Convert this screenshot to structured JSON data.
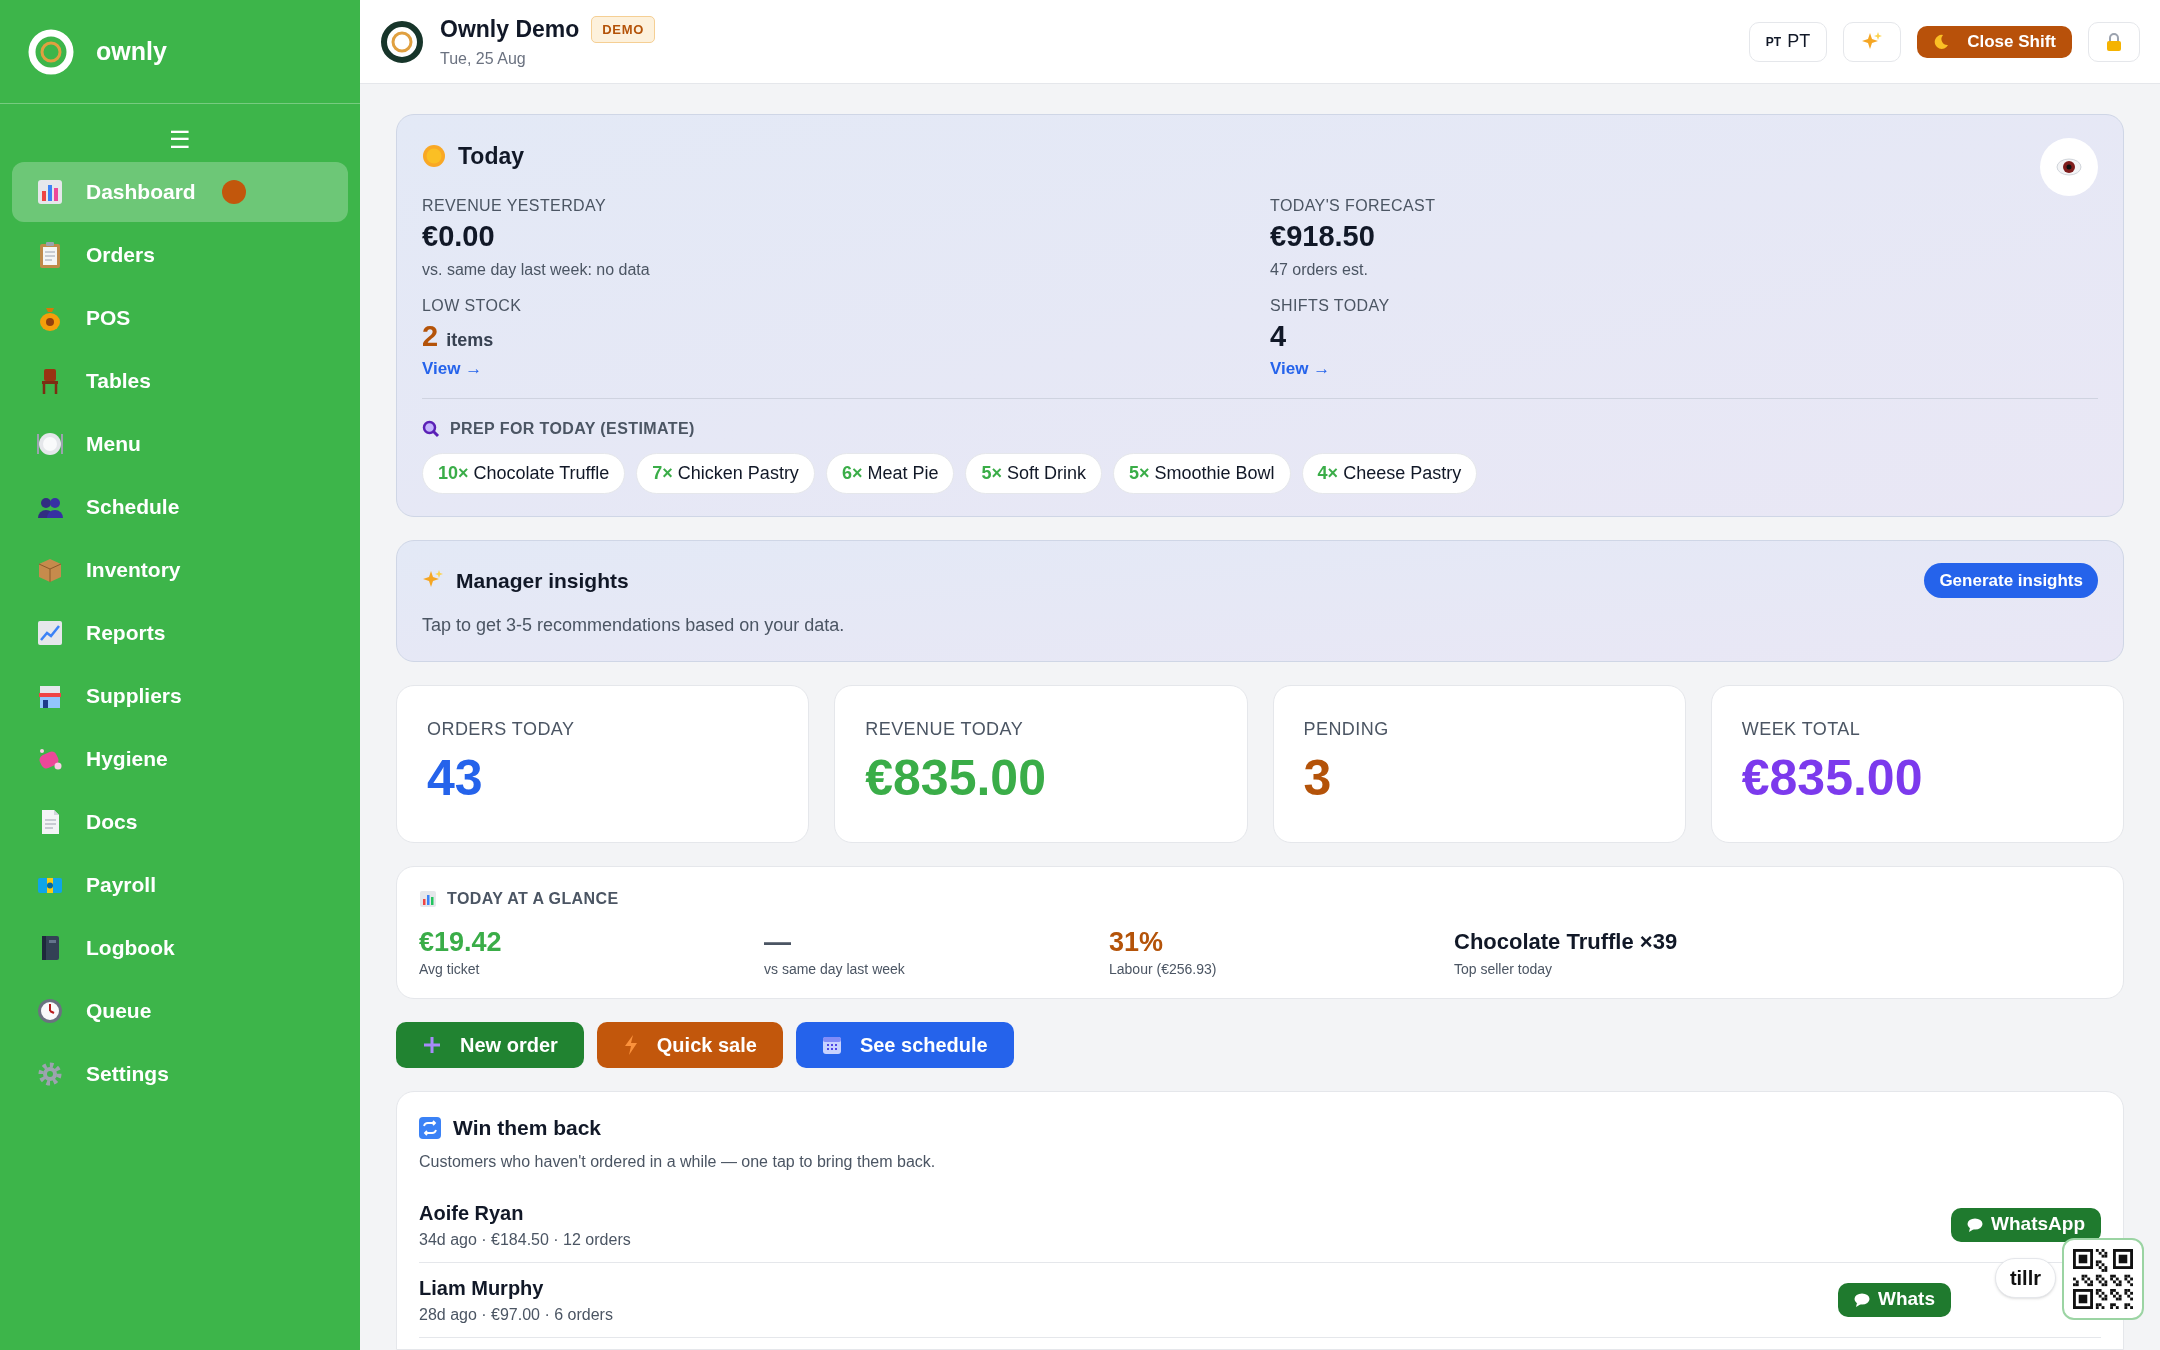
{
  "sidebar": {
    "brand": "ownly",
    "menu_glyph": "☰",
    "items": [
      {
        "label": "Dashboard",
        "selected": true,
        "badge": true
      },
      {
        "label": "Orders",
        "selected": false,
        "badge": false
      },
      {
        "label": "POS",
        "selected": false,
        "badge": false
      },
      {
        "label": "Tables",
        "selected": false,
        "badge": false
      },
      {
        "label": "Menu",
        "selected": false,
        "badge": false
      },
      {
        "label": "Schedule",
        "selected": false,
        "badge": false
      },
      {
        "label": "Inventory",
        "selected": false,
        "badge": false
      },
      {
        "label": "Reports",
        "selected": false,
        "badge": false
      },
      {
        "label": "Suppliers",
        "selected": false,
        "badge": false
      },
      {
        "label": "Hygiene",
        "selected": false,
        "badge": false
      },
      {
        "label": "Docs",
        "selected": false,
        "badge": false
      },
      {
        "label": "Payroll",
        "selected": false,
        "badge": false
      },
      {
        "label": "Logbook",
        "selected": false,
        "badge": false
      },
      {
        "label": "Queue",
        "selected": false,
        "badge": false
      },
      {
        "label": "Settings",
        "selected": false,
        "badge": false
      }
    ]
  },
  "header": {
    "title": "Ownly Demo",
    "badge": "DEMO",
    "date": "Tue, 25 Aug",
    "language": {
      "code": "PT",
      "label": "PT"
    },
    "close_shift": "Close Shift"
  },
  "today": {
    "title": "Today",
    "metrics": [
      {
        "label": "REVENUE YESTERDAY",
        "value": "€0.00",
        "color": "#111827",
        "note": "vs. same day last week: no data"
      },
      {
        "label": "TODAY'S FORECAST",
        "value": "€918.50",
        "color": "#111827",
        "note": "47 orders est."
      },
      {
        "label": "LOW STOCK",
        "value": "2",
        "color": "#b45309",
        "unit": "items",
        "link": "View →"
      },
      {
        "label": "SHIFTS TODAY",
        "value": "4",
        "color": "#111827",
        "link": "View →"
      }
    ],
    "prep_title": "PREP FOR TODAY (ESTIMATE)",
    "prep": [
      {
        "qty": "10×",
        "name": "Chocolate Truffle"
      },
      {
        "qty": "7×",
        "name": "Chicken Pastry"
      },
      {
        "qty": "6×",
        "name": "Meat Pie"
      },
      {
        "qty": "5×",
        "name": "Soft Drink"
      },
      {
        "qty": "5×",
        "name": "Smoothie Bowl"
      },
      {
        "qty": "4×",
        "name": "Cheese Pastry"
      }
    ]
  },
  "insights": {
    "title": "Manager insights",
    "text": "Tap to get 3-5 recommendations based on your data.",
    "button": "Generate insights"
  },
  "stats": [
    {
      "label": "ORDERS TODAY",
      "value": "43",
      "color": "#2563eb"
    },
    {
      "label": "REVENUE TODAY",
      "value": "€835.00",
      "color": "#3aad48"
    },
    {
      "label": "PENDING",
      "value": "3",
      "color": "#b45309"
    },
    {
      "label": "WEEK TOTAL",
      "value": "€835.00",
      "color": "#7c3aed"
    }
  ],
  "glance": {
    "title": "TODAY AT A GLANCE",
    "items": [
      {
        "kind": "metric",
        "value": "€19.42",
        "caption": "Avg ticket",
        "color": "#3aad48"
      },
      {
        "kind": "metric",
        "value": "—",
        "caption": "vs same day last week",
        "color": "#4b5563"
      },
      {
        "kind": "metric",
        "value": "31%",
        "caption": "Labour (€256.93)",
        "color": "#b45309"
      },
      {
        "kind": "text",
        "value": "Chocolate Truffle ×39",
        "caption": "Top seller today",
        "color": "#111827"
      }
    ]
  },
  "actions": [
    {
      "label": "New order",
      "color": "#218331"
    },
    {
      "label": "Quick sale",
      "color": "#c2570c"
    },
    {
      "label": "See schedule",
      "color": "#2563eb"
    }
  ],
  "win_back": {
    "title": "Win them back",
    "subtitle": "Customers who haven't ordered in a while — one tap to bring them back.",
    "customers": [
      {
        "name": "Aoife Ryan",
        "detail": "34d ago · €184.50 · 12 orders",
        "action": "WhatsApp"
      },
      {
        "name": "Liam Murphy",
        "detail": "28d ago · €97.00 · 6 orders",
        "action": "Whats"
      }
    ]
  },
  "widget": {
    "label": "tillr"
  }
}
